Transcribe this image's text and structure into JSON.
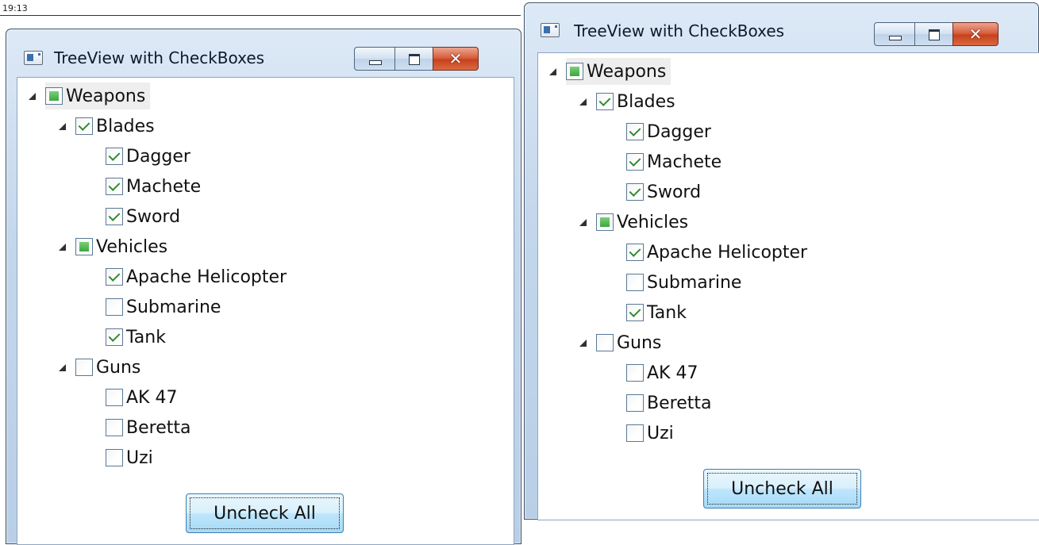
{
  "timestamp": "19:13",
  "window": {
    "title": "TreeView with CheckBoxes",
    "uncheck_all_label": "Uncheck All"
  },
  "tree": [
    {
      "label": "Weapons",
      "state": "partial",
      "expanded": true,
      "children": [
        {
          "label": "Blades",
          "state": "checked",
          "expanded": true,
          "children": [
            {
              "label": "Dagger",
              "state": "checked"
            },
            {
              "label": "Machete",
              "state": "checked"
            },
            {
              "label": "Sword",
              "state": "checked"
            }
          ]
        },
        {
          "label": "Vehicles",
          "state": "partial",
          "expanded": true,
          "children": [
            {
              "label": "Apache Helicopter",
              "state": "checked"
            },
            {
              "label": "Submarine",
              "state": "unchecked"
            },
            {
              "label": "Tank",
              "state": "checked"
            }
          ]
        },
        {
          "label": "Guns",
          "state": "unchecked",
          "expanded": true,
          "children": [
            {
              "label": "AK 47",
              "state": "unchecked"
            },
            {
              "label": "Beretta",
              "state": "unchecked"
            },
            {
              "label": "Uzi",
              "state": "unchecked"
            }
          ]
        }
      ]
    }
  ]
}
